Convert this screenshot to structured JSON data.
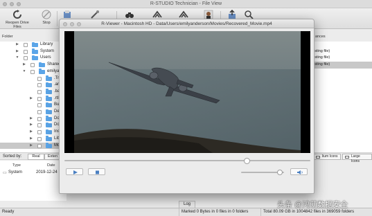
{
  "app": {
    "title": "R-STUDIO Technician - File View"
  },
  "toolbar": {
    "buttons": [
      {
        "label": "Reopen Drive Files",
        "icon": "reopen-icon"
      },
      {
        "label": "Stop",
        "icon": "stop-icon"
      }
    ],
    "unlabeled_icons": [
      "recover-icon",
      "mark-icon",
      "find-icon",
      "binoculars-icon",
      "hex-editor-icon",
      "user-icon",
      "export-icon",
      "search-icon"
    ]
  },
  "panels": {
    "folders_header": "Folder",
    "right_header": "ances"
  },
  "tree": {
    "rows": [
      {
        "label": "Library"
      },
      {
        "label": "System"
      },
      {
        "label": "Users"
      },
      {
        "label": "Shared"
      },
      {
        "label": "emilya"
      },
      {
        "label": ".Tra"
      },
      {
        "label": ".an"
      },
      {
        "label": ".ba"
      },
      {
        "label": ".rtl"
      },
      {
        "label": "Buy"
      },
      {
        "label": "Des"
      },
      {
        "label": "Doc"
      },
      {
        "label": "Dow"
      },
      {
        "label": "Ins"
      },
      {
        "label": "Libr"
      },
      {
        "label": "Mo"
      }
    ]
  },
  "right_list": {
    "rows": [
      "isting file)",
      "isting file)",
      "isting file)"
    ]
  },
  "sorted_bar": {
    "label": "Sorted by:",
    "segments": [
      "Real",
      "Exten"
    ],
    "icon_views": [
      "lium Icons",
      "Large Icons"
    ]
  },
  "bottom_table": {
    "headers": {
      "type": "Type",
      "date": "Date"
    },
    "row": {
      "type": "System",
      "date": "2019-12-24"
    }
  },
  "log_tab": "Log",
  "status": {
    "ready": "Ready",
    "marked": "Marked 0 Bytes in 0 files in 0 folders",
    "total": "Total 80.09 GB in 1004842 files in 369059 folders"
  },
  "watermark": "头条 @鸿萌数据安全",
  "viewer": {
    "title": "R-Viewer - Macintosh HD - Data/Users/emilyanderson/Movies/Recovered_Movie.mp4",
    "seek_position": 0.74,
    "volume_level": 0.9,
    "controls": {
      "play": "play-icon",
      "stop": "stop-icon",
      "speaker": "speaker-icon"
    }
  },
  "colors": {
    "folder": "#5ba5e8",
    "selection": "#c8c8c8",
    "video_sky_top": "#7d8a8c",
    "video_sea": "#5a6a70"
  }
}
